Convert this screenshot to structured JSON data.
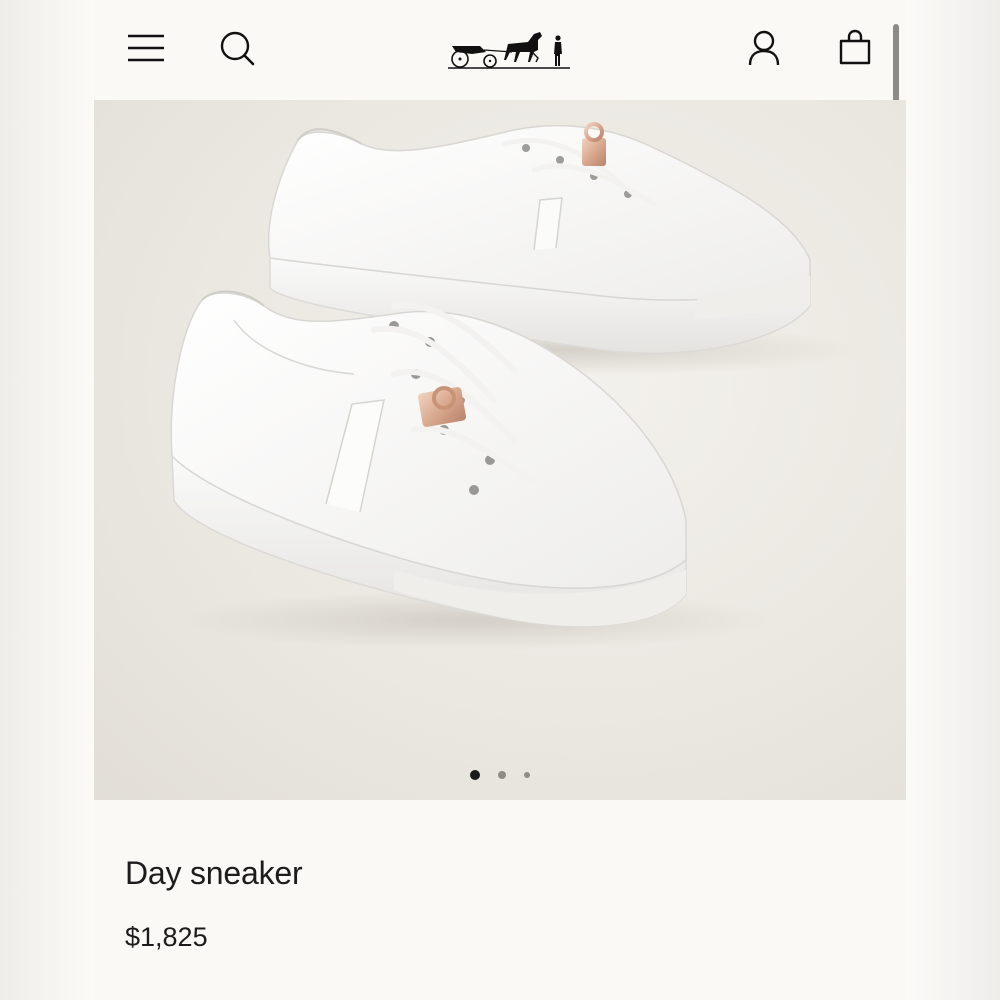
{
  "header": {
    "icons": [
      "menu-icon",
      "search-icon",
      "account-icon",
      "shopping-bag-icon"
    ]
  },
  "gallery": {
    "slide_count": 3,
    "active_slide": 1,
    "colors": {
      "background": "#ebe8e2",
      "shoe": "#ffffff",
      "hardware": "#d9a98f"
    }
  },
  "product": {
    "name": "Day sneaker",
    "price": "$1,825"
  }
}
